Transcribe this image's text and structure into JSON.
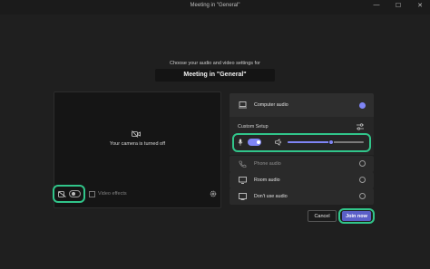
{
  "window": {
    "title": "Meeting in \"General\"",
    "controls": [
      "—",
      "☐",
      "✕"
    ]
  },
  "prompt": "Choose your audio and video settings for",
  "meeting_title": "Meeting in \"General\"",
  "video": {
    "camera_message": "Your camera is turned off",
    "camera_on": false,
    "effects_label": "Video effects"
  },
  "audio": {
    "computer_audio_label": "Computer audio",
    "computer_audio_selected": true,
    "custom_setup_label": "Custom Setup",
    "mic_on": true,
    "speaker_volume_percent": 57,
    "options": [
      {
        "label": "Phone audio",
        "icon": "phone-icon",
        "enabled": false
      },
      {
        "label": "Room audio",
        "icon": "monitor-icon",
        "enabled": true
      },
      {
        "label": "Don't use audio",
        "icon": "speaker-off-icon",
        "enabled": true
      }
    ]
  },
  "actions": {
    "cancel_label": "Cancel",
    "join_label": "Join now"
  },
  "colors": {
    "accent": "#7f85f5",
    "primary_button": "#5b5fc7",
    "highlight_outline": "#31c58a",
    "background": "#1f1f1f"
  }
}
